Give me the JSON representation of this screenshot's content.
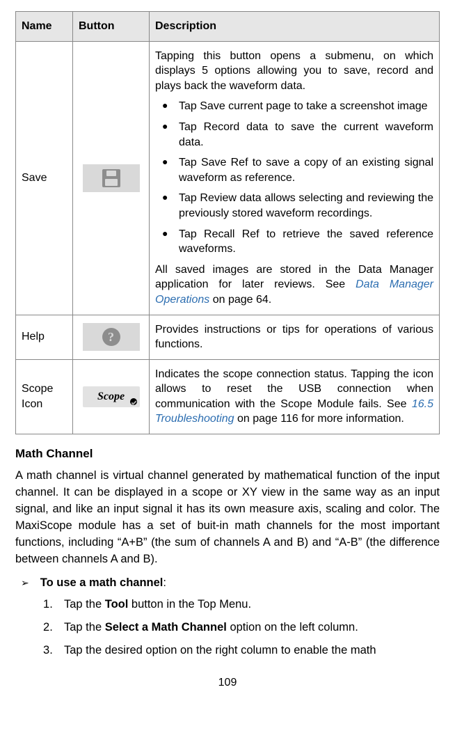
{
  "table": {
    "headers": {
      "name": "Name",
      "button": "Button",
      "description": "Description"
    },
    "rows": {
      "save": {
        "name": "Save",
        "button_icon": "save-icon",
        "intro": "Tapping this button opens a submenu, on which displays 5 options allowing you to save, record and plays back the waveform data.",
        "bullets": {
          "b1": "Tap Save current page to take a screenshot image",
          "b2": "Tap Record data to save the current waveform data.",
          "b3": "Tap Save Ref to save a copy of an existing signal waveform as reference.",
          "b4": "Tap Review data allows selecting and reviewing the previously stored waveform recordings.",
          "b5": "Tap Recall Ref to retrieve the saved reference waveforms."
        },
        "outro_pre": "All saved images are stored in the Data Manager application for later reviews. See ",
        "outro_link": "Data Manager Operations",
        "outro_post": " on page 64."
      },
      "help": {
        "name": "Help",
        "button_icon": "help-icon",
        "desc": "Provides instructions or tips for operations of various functions."
      },
      "scope": {
        "name": "Scope Icon",
        "button_label": "Scope",
        "desc_pre": "Indicates the scope connection status. Tapping the icon allows to reset the USB connection when communication with the Scope Module fails. See ",
        "desc_link": "16.5 Troubleshooting",
        "desc_post": " on page 116 for more information."
      }
    }
  },
  "math_channel": {
    "heading": "Math Channel",
    "paragraph": "A math channel is virtual channel generated by mathematical function of the input channel. It can be displayed in a scope or XY view in the same way as an input signal, and like an input signal it has its own measure axis, scaling and color. The MaxiScope module has a set of buit-in math channels for the most important functions, including “A+B” (the sum of channels A and B) and “A-B” (the difference between channels A and B).",
    "procedure_title": "To use a math channel",
    "steps": {
      "s1_pre": "Tap the ",
      "s1_bold": "Tool",
      "s1_post": " button in the Top Menu.",
      "s2_pre": "Tap the ",
      "s2_bold": "Select a Math Channel",
      "s2_post": " option on the left column.",
      "s3": "Tap the desired option on the right column to enable the math"
    }
  },
  "page_number": "109"
}
